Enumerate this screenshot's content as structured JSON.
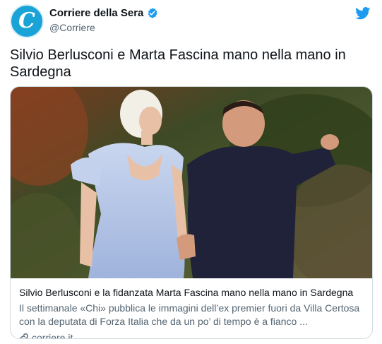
{
  "author": {
    "name": "Corriere della Sera",
    "handle": "@Corriere",
    "avatar_letter": "C",
    "avatar_color": "#1aa3d6"
  },
  "tweet": {
    "text": "Silvio Berlusconi e Marta Fascina mano nella mano in Sardegna"
  },
  "card": {
    "title": "Silvio Berlusconi e la fidanzata Marta Fascina mano nella mano in Sardegna",
    "description": "Il settimanale «Chi» pubblica le immagini dell’ex premier fuori da Villa Certosa con la deputata di Forza Italia che da un po’ di tempo è a fianco ...",
    "domain": "corriere.it"
  },
  "icons": {
    "verified": "verified-badge-icon",
    "brand": "twitter-bird-icon",
    "link": "link-icon"
  },
  "colors": {
    "twitter_blue": "#1d9bf0",
    "text_primary": "#0f1419",
    "text_secondary": "#536471",
    "border": "#cfd9de"
  }
}
